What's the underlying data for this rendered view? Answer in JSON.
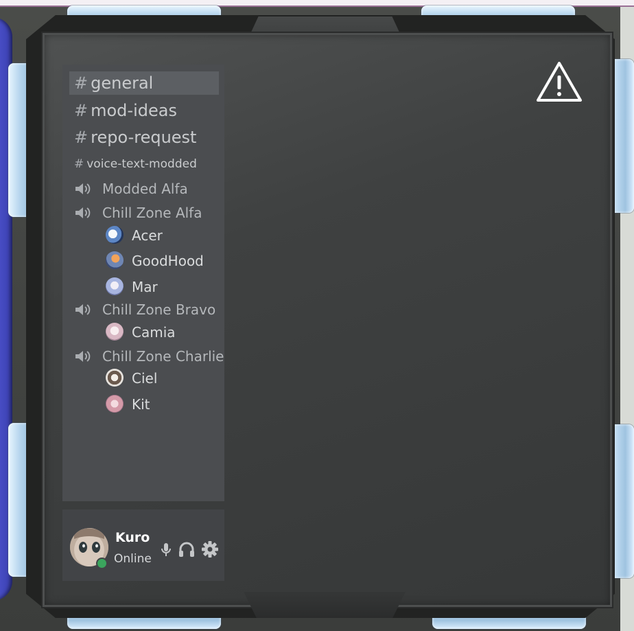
{
  "window": {
    "accent": "#4b51c9",
    "panel_bg": "#3f4141",
    "sidebar_bg": "#4b4d50"
  },
  "channels": {
    "text": [
      {
        "name": "general",
        "selected": true
      },
      {
        "name": "mod-ideas",
        "selected": false
      },
      {
        "name": "repo-request",
        "selected": false
      },
      {
        "name": "voice-text-modded",
        "selected": false
      }
    ],
    "hash_symbol": "#",
    "voice": [
      {
        "name": "Modded Alfa",
        "members": []
      },
      {
        "name": "Chill Zone Alfa",
        "members": [
          "Acer",
          "GoodHood",
          "Mar"
        ]
      },
      {
        "name": "Chill Zone Bravo",
        "members": [
          "Camia"
        ]
      },
      {
        "name": "Chill Zone Charlie",
        "members": [
          "Ciel",
          "Kit"
        ]
      }
    ]
  },
  "icons": {
    "voice": "speaker-icon",
    "warning": "warning-triangle-icon",
    "mic": "microphone-icon",
    "headphones": "headphones-icon",
    "settings": "gear-icon"
  },
  "user": {
    "name": "Kuro",
    "status": "Online",
    "status_color": "#3ba55d"
  }
}
